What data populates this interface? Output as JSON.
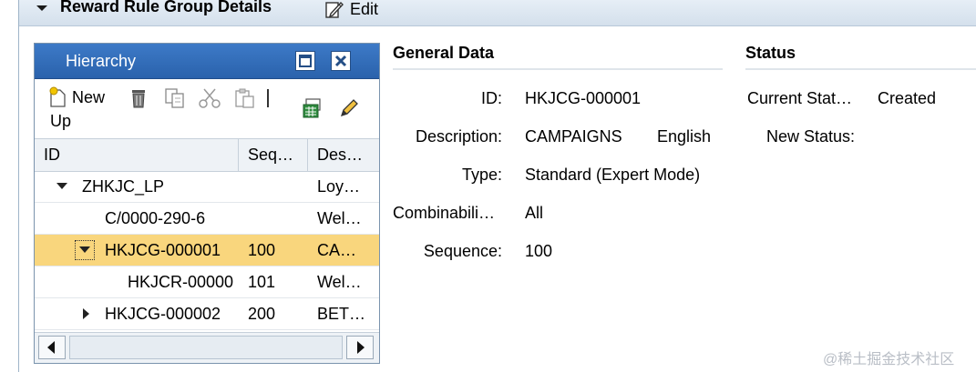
{
  "header": {
    "title": "Reward Rule Group Details",
    "edit_label": "Edit"
  },
  "hierarchy": {
    "title": "Hierarchy",
    "toolbar": {
      "new_label": "New",
      "up_label": "Up"
    },
    "columns": [
      "ID",
      "Seq…",
      "Des…"
    ],
    "rows": [
      {
        "id": "ZHKJC_LP",
        "seq": "",
        "desc": "Loy…",
        "expander": "expanded"
      },
      {
        "id": "C/0000-290-6",
        "seq": "",
        "desc": "Wel…",
        "expander": "none"
      },
      {
        "id": "HKJCG-000001",
        "seq": "100",
        "desc": "CA…",
        "expander": "expanded"
      },
      {
        "id": "HKJCR-00000",
        "seq": "101",
        "desc": "Wel…",
        "expander": "none"
      },
      {
        "id": "HKJCG-000002",
        "seq": "200",
        "desc": "BET…",
        "expander": "collapsed"
      }
    ],
    "selected_row": 2
  },
  "general": {
    "title": "General Data",
    "fields": {
      "id_label": "ID:",
      "id_value": "HKJCG-000001",
      "description_label": "Description:",
      "description_value": "CAMPAIGNS",
      "language_value": "English",
      "type_label": "Type:",
      "type_value": "Standard (Expert Mode)",
      "combinability_label": "Combinabili…",
      "combinability_value": "All",
      "sequence_label": "Sequence:",
      "sequence_value": "100"
    }
  },
  "status": {
    "title": "Status",
    "current_label": "Current Stat…",
    "current_value": "Created",
    "new_label": "New Status:"
  },
  "watermark": "@稀土掘金技术社区",
  "colors": {
    "titlebar": "#2f6db8",
    "selected_row": "#f9d67d"
  }
}
